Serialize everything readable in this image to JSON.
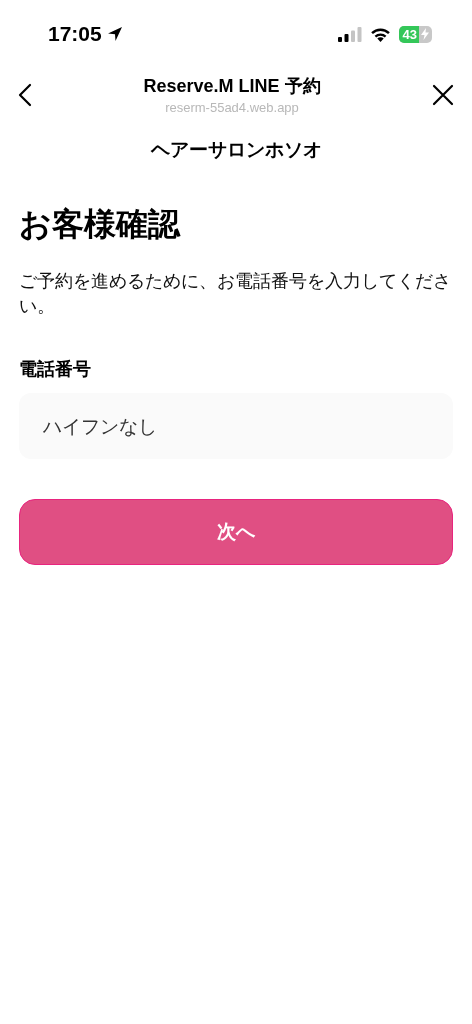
{
  "status_bar": {
    "time": "17:05",
    "battery": "43"
  },
  "nav": {
    "title": "Reserve.M LINE 予約",
    "url": "reserm-55ad4.web.app"
  },
  "shop_name": "ヘアーサロンホソオ",
  "heading": "お客様確認",
  "description": "ご予約を進めるために、お電話番号を入力してください。",
  "phone": {
    "label": "電話番号",
    "placeholder": "ハイフンなし"
  },
  "next_button": "次へ"
}
